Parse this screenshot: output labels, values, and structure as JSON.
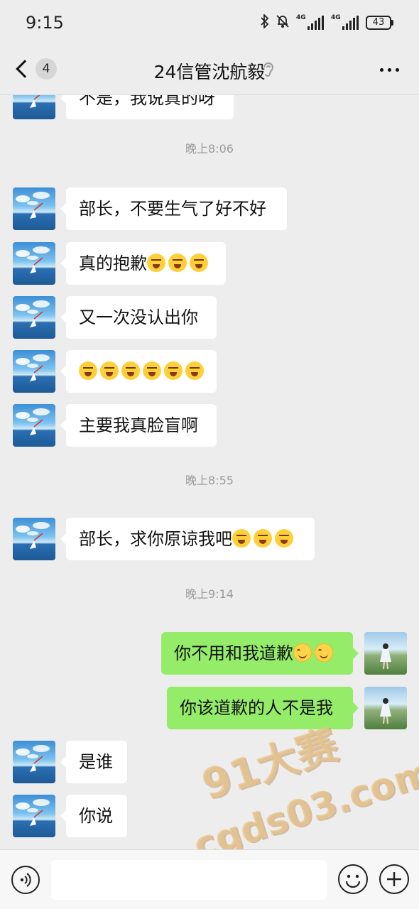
{
  "status_bar": {
    "time": "9:15",
    "net1": "4G",
    "net2": "4G",
    "battery": "43",
    "icons": [
      "bluetooth-icon",
      "mute-bell-icon",
      "signal-icon",
      "battery-icon"
    ]
  },
  "header": {
    "unread_count": "4",
    "title": "24信管沈航毅",
    "icons": [
      "back-arrow-icon",
      "ear-icon",
      "more-icon"
    ]
  },
  "messages": [
    {
      "side": "left",
      "text": "不是，我说真的呀",
      "emojis": [],
      "emoji_type": ""
    },
    {
      "type": "time",
      "text": "晚上8:06"
    },
    {
      "side": "left",
      "text": "部长，不要生气了好不好",
      "emojis": [],
      "emoji_type": ""
    },
    {
      "side": "left",
      "text": "真的抱歉",
      "emojis": [
        "cry",
        "cry",
        "cry"
      ],
      "emoji_type": "cry"
    },
    {
      "side": "left",
      "text": "又一次没认出你",
      "emojis": [],
      "emoji_type": ""
    },
    {
      "side": "left",
      "text": "",
      "emojis": [
        "cry",
        "cry",
        "cry",
        "cry",
        "cry",
        "cry"
      ],
      "emoji_type": "cry"
    },
    {
      "side": "left",
      "text": "主要我真脸盲啊",
      "emojis": [],
      "emoji_type": ""
    },
    {
      "type": "time",
      "text": "晚上8:55"
    },
    {
      "side": "left",
      "text": "部长，求你原谅我吧",
      "emojis": [
        "cry",
        "cry",
        "cry"
      ],
      "emoji_type": "cry"
    },
    {
      "type": "time",
      "text": "晚上9:14"
    },
    {
      "side": "right",
      "text": "你不用和我道歉",
      "emojis": [
        "smile",
        "smile"
      ],
      "emoji_type": "smile"
    },
    {
      "side": "right",
      "text": "你该道歉的人不是我",
      "emojis": [],
      "emoji_type": ""
    },
    {
      "side": "left",
      "text": "是谁",
      "emojis": [],
      "emoji_type": ""
    },
    {
      "side": "left",
      "text": "你说",
      "emojis": [],
      "emoji_type": ""
    }
  ],
  "watermark": {
    "line1": "91大赛",
    "line2": "cgds03.com"
  },
  "input_bar": {
    "value": "",
    "icons": [
      "voice-icon",
      "emoji-icon",
      "plus-icon"
    ]
  },
  "colors": {
    "background": "#ededed",
    "bubble_left": "#ffffff",
    "bubble_right": "#95ec69",
    "timestamp": "#9a9a9a"
  }
}
